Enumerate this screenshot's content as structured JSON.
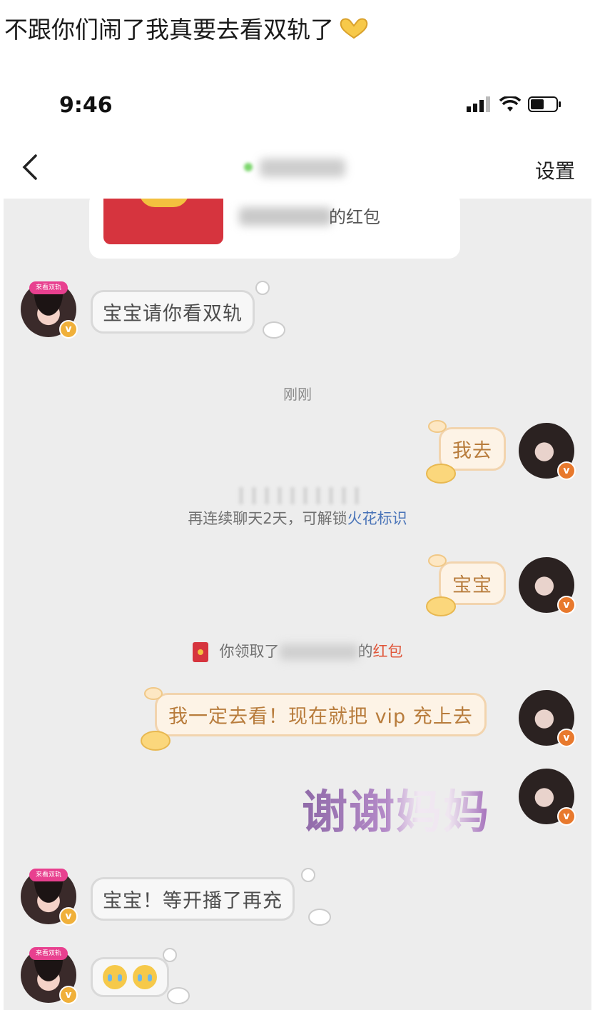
{
  "post": {
    "caption": "不跟你们闹了我真要去看双轨了"
  },
  "statusbar": {
    "time": "9:46"
  },
  "navbar": {
    "settings_label": "设置"
  },
  "red_packet_card": {
    "suffix": "的红包"
  },
  "messages": {
    "m1": "宝宝请你看双轨",
    "timestamp": "刚刚",
    "m2": "我去",
    "streak_notice_prefix": "再连续聊天2天，可解锁",
    "streak_notice_link": "火花标识",
    "m3": "宝宝",
    "packet_notice_prefix": "你领取了",
    "packet_notice_mid": "的",
    "packet_notice_link": "红包",
    "m4": "我一定去看！现在就把 vip 充上去",
    "m5": "谢谢妈妈",
    "m6": "宝宝！等开播了再充"
  },
  "avatars": {
    "contact_badge": "来看双轨",
    "verified_mark": "v"
  },
  "colors": {
    "accent_red": "#d6343e",
    "link_blue": "#4a74b8",
    "link_red": "#e0573b",
    "my_bubble_text": "#b87c3c"
  }
}
